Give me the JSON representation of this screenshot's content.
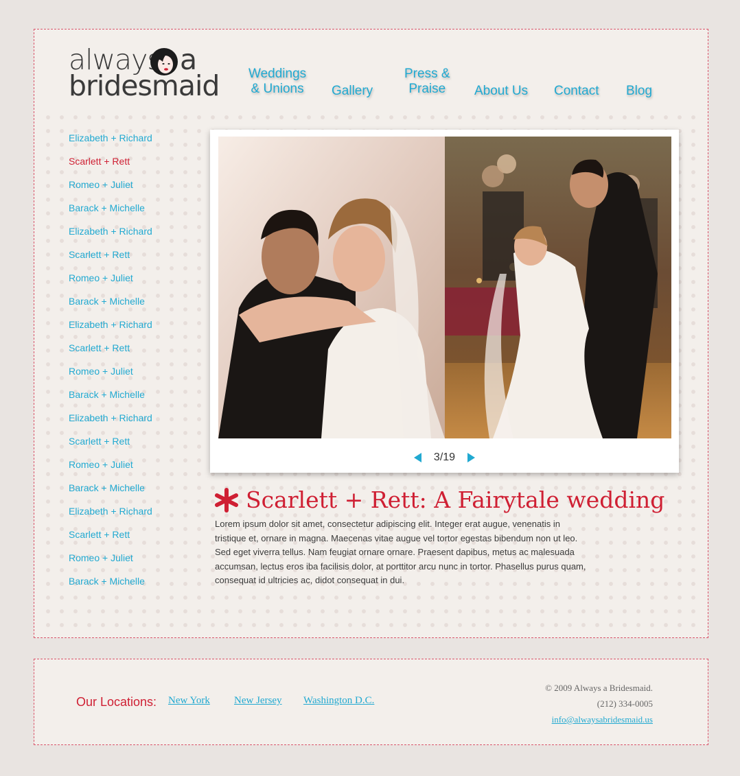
{
  "logo": {
    "line1": "always",
    "a": "a",
    "line2": "bridesmaid"
  },
  "nav": {
    "weddings": "Weddings\n& Unions",
    "gallery": "Gallery",
    "press": "Press &\nPraise",
    "about": "About Us",
    "contact": "Contact",
    "blog": "Blog"
  },
  "sidebar": {
    "items": [
      {
        "label": "Elizabeth + Richard"
      },
      {
        "label": "Scarlett + Rett"
      },
      {
        "label": "Romeo + Juliet"
      },
      {
        "label": "Barack + Michelle"
      },
      {
        "label": "Elizabeth + Richard"
      },
      {
        "label": "Scarlett + Rett"
      },
      {
        "label": "Romeo + Juliet"
      },
      {
        "label": "Barack + Michelle"
      },
      {
        "label": "Elizabeth + Richard"
      },
      {
        "label": "Scarlett + Rett"
      },
      {
        "label": "Romeo + Juliet"
      },
      {
        "label": "Barack + Michelle"
      },
      {
        "label": "Elizabeth + Richard"
      },
      {
        "label": "Scarlett + Rett"
      },
      {
        "label": "Romeo + Juliet"
      },
      {
        "label": "Barack + Michelle"
      },
      {
        "label": "Elizabeth + Richard"
      },
      {
        "label": "Scarlett + Rett"
      },
      {
        "label": "Romeo + Juliet"
      },
      {
        "label": "Barack + Michelle"
      }
    ],
    "active_index": 1
  },
  "gallery": {
    "counter": "3/19"
  },
  "article": {
    "title": "Scarlett + Rett: A Fairytale wedding",
    "body": "Lorem ipsum dolor sit amet, consectetur adipiscing elit. Integer erat augue, venenatis in tristique et, ornare in magna. Maecenas vitae augue vel tortor egestas bibendum non ut leo. Sed eget viverra tellus. Nam feugiat ornare ornare. Praesent dapibus, metus ac malesuada accumsan, lectus eros iba facilisis dolor, at porttitor arcu nunc in tortor. Phasellus purus quam, consequat id ultricies ac, didot consequat in dui."
  },
  "footer": {
    "locations_label": "Our Locations:",
    "locations": [
      "New York",
      "New Jersey",
      "Washington D.C."
    ],
    "copyright": "© 2009 Always a Bridesmaid.",
    "phone": "(212) 334-0005",
    "email": "info@alwaysabridesmaid.us"
  },
  "colors": {
    "accent_blue": "#21a9d1",
    "accent_red": "#cf1f33",
    "panel_bg": "#f3efeb",
    "page_bg": "#e9e4e1"
  }
}
